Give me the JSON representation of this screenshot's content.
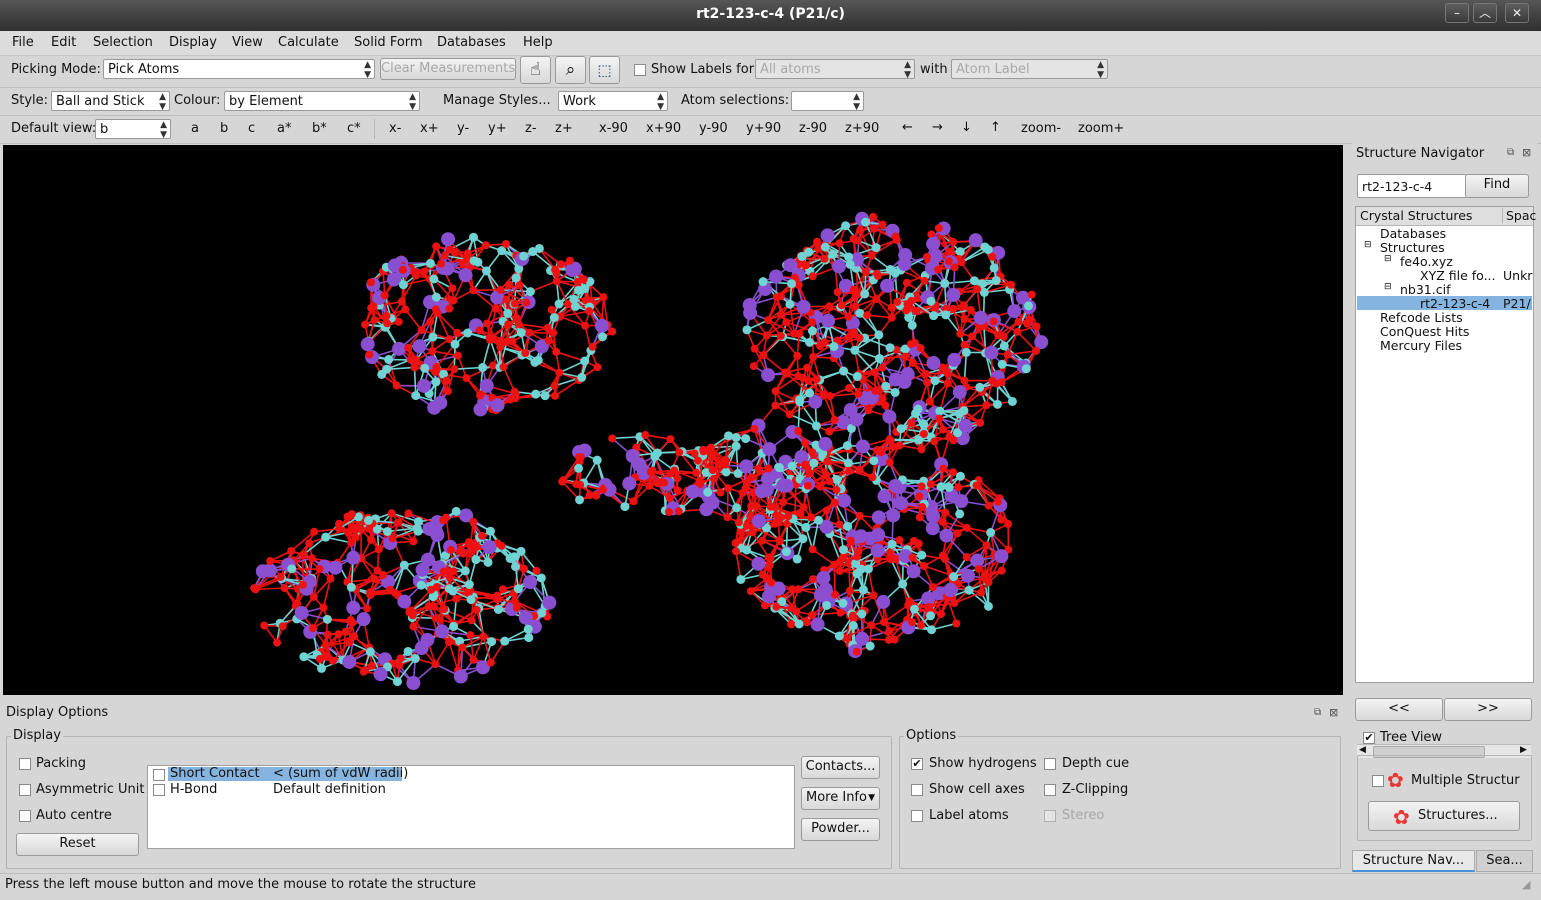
{
  "window": {
    "title": "rt2-123-c-4 (P21/c)",
    "controls": [
      "–",
      "︿",
      "✕"
    ]
  },
  "menubar": [
    "File",
    "Edit",
    "Selection",
    "Display",
    "View",
    "Calculate",
    "Solid Form",
    "Databases",
    "Help"
  ],
  "toolbar1": {
    "picking_mode_label": "Picking Mode:",
    "picking_mode_value": "Pick Atoms",
    "clear_measurements": "Clear Measurements",
    "show_labels_label": "Show Labels for",
    "show_labels_value": "All atoms",
    "with_label": "with",
    "with_value": "Atom Label"
  },
  "toolbar2": {
    "style_label": "Style:",
    "style_value": "Ball and Stick",
    "colour_label": "Colour:",
    "colour_value": "by Element",
    "manage_styles": "Manage Styles...",
    "manage_styles_value": "Work",
    "atom_selections_label": "Atom selections:",
    "atom_selections_value": ""
  },
  "toolbar3": {
    "default_view_label": "Default view:",
    "default_view_value": "b",
    "axis_buttons": [
      "a",
      "b",
      "c",
      "a*",
      "b*",
      "c*"
    ],
    "move_buttons": [
      "x-",
      "x+",
      "y-",
      "y+",
      "z-",
      "z+"
    ],
    "rotate_buttons": [
      "x-90",
      "x+90",
      "y-90",
      "y+90",
      "z-90",
      "z+90"
    ],
    "arrow_buttons": [
      "←",
      "→",
      "↓",
      "↑"
    ],
    "zoom_buttons": [
      "zoom-",
      "zoom+"
    ]
  },
  "navigator": {
    "title": "Structure Navigator",
    "search_value": "rt2-123-c-4",
    "find_button": "Find",
    "col_crystal": "Crystal Structures",
    "col_space": "Spac",
    "tree": [
      {
        "label": "Databases",
        "extra": "",
        "level": 0
      },
      {
        "label": "Structures",
        "extra": "",
        "level": 0
      },
      {
        "label": "fe4o.xyz",
        "extra": "",
        "level": 1
      },
      {
        "label": "XYZ file fo...",
        "extra": "Unkr",
        "level": 2
      },
      {
        "label": "nb31.cif",
        "extra": "",
        "level": 1
      },
      {
        "label": "rt2-123-c-4",
        "extra": "P21/",
        "level": 2
      },
      {
        "label": "Refcode Lists",
        "extra": "",
        "level": 0
      },
      {
        "label": "ConQuest Hits",
        "extra": "",
        "level": 0
      },
      {
        "label": "Mercury Files",
        "extra": "",
        "level": 0
      }
    ],
    "prev_button": "<<",
    "next_button": ">>",
    "tree_view_label": "Tree View",
    "multiple_structures_label": "Multiple Structur",
    "structures_button": "Structures...",
    "tab_nav": "Structure Nav...",
    "tab_search": "Sea..."
  },
  "display_options": {
    "title": "Display Options",
    "display_group": "Display",
    "packing": "Packing",
    "asymmetric_unit": "Asymmetric Unit",
    "auto_centre": "Auto centre",
    "reset": "Reset",
    "contacts": [
      {
        "name": "Short Contact",
        "definition": "< (sum of vdW radii)"
      },
      {
        "name": "H-Bond",
        "definition": "Default definition"
      }
    ],
    "contacts_button": "Contacts...",
    "more_info_button": "More Info",
    "powder_button": "Powder...",
    "options_group": "Options",
    "show_hydrogens": "Show hydrogens",
    "show_cell_axes": "Show cell axes",
    "label_atoms": "Label atoms",
    "depth_cue": "Depth cue",
    "z_clipping": "Z-Clipping",
    "stereo": "Stereo"
  },
  "status_bar": "Press the left mouse button and move the mouse to rotate the structure",
  "colors": {
    "oxygen": "#ee1111",
    "niobium": "#8a4fd0",
    "metal": "#6fd3d3",
    "background": "#000000",
    "selection": "#86b4e0"
  }
}
